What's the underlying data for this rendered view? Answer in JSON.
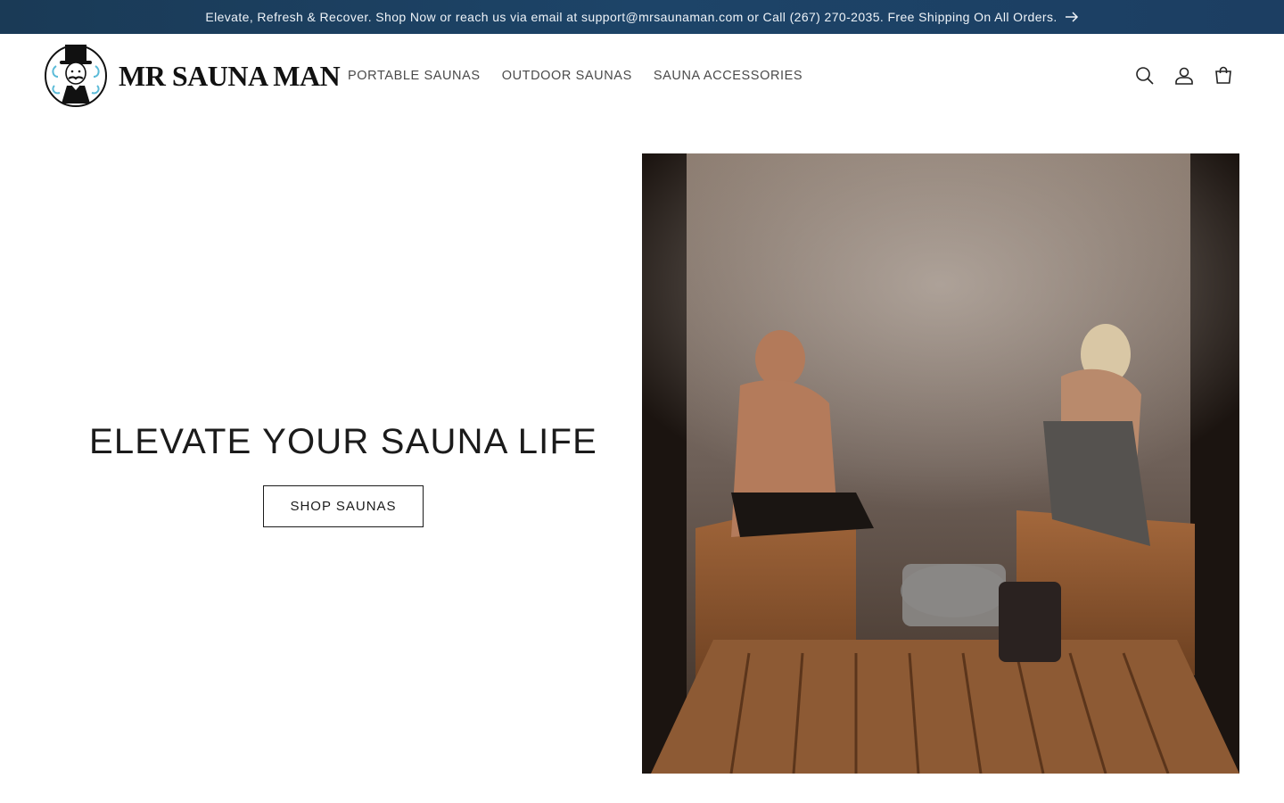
{
  "announcement": {
    "text": "Elevate, Refresh & Recover. Shop Now or reach us via email at support@mrsaunaman.com or Call (267) 270-2035. Free Shipping On All Orders.",
    "arrow_icon": "arrow-right-icon"
  },
  "header": {
    "logo_text": "MR SAUNA MAN",
    "nav": [
      {
        "label": "PORTABLE SAUNAS"
      },
      {
        "label": "OUTDOOR SAUNAS"
      },
      {
        "label": "SAUNA ACCESSORIES"
      }
    ],
    "icons": [
      "search-icon",
      "account-icon",
      "cart-icon"
    ]
  },
  "hero": {
    "title": "ELEVATE YOUR SAUNA LIFE",
    "button_label": "SHOP SAUNAS"
  },
  "colors": {
    "announcement_bg": "#1d4468",
    "text": "#121212",
    "nav_text": "#4a4a4a"
  }
}
